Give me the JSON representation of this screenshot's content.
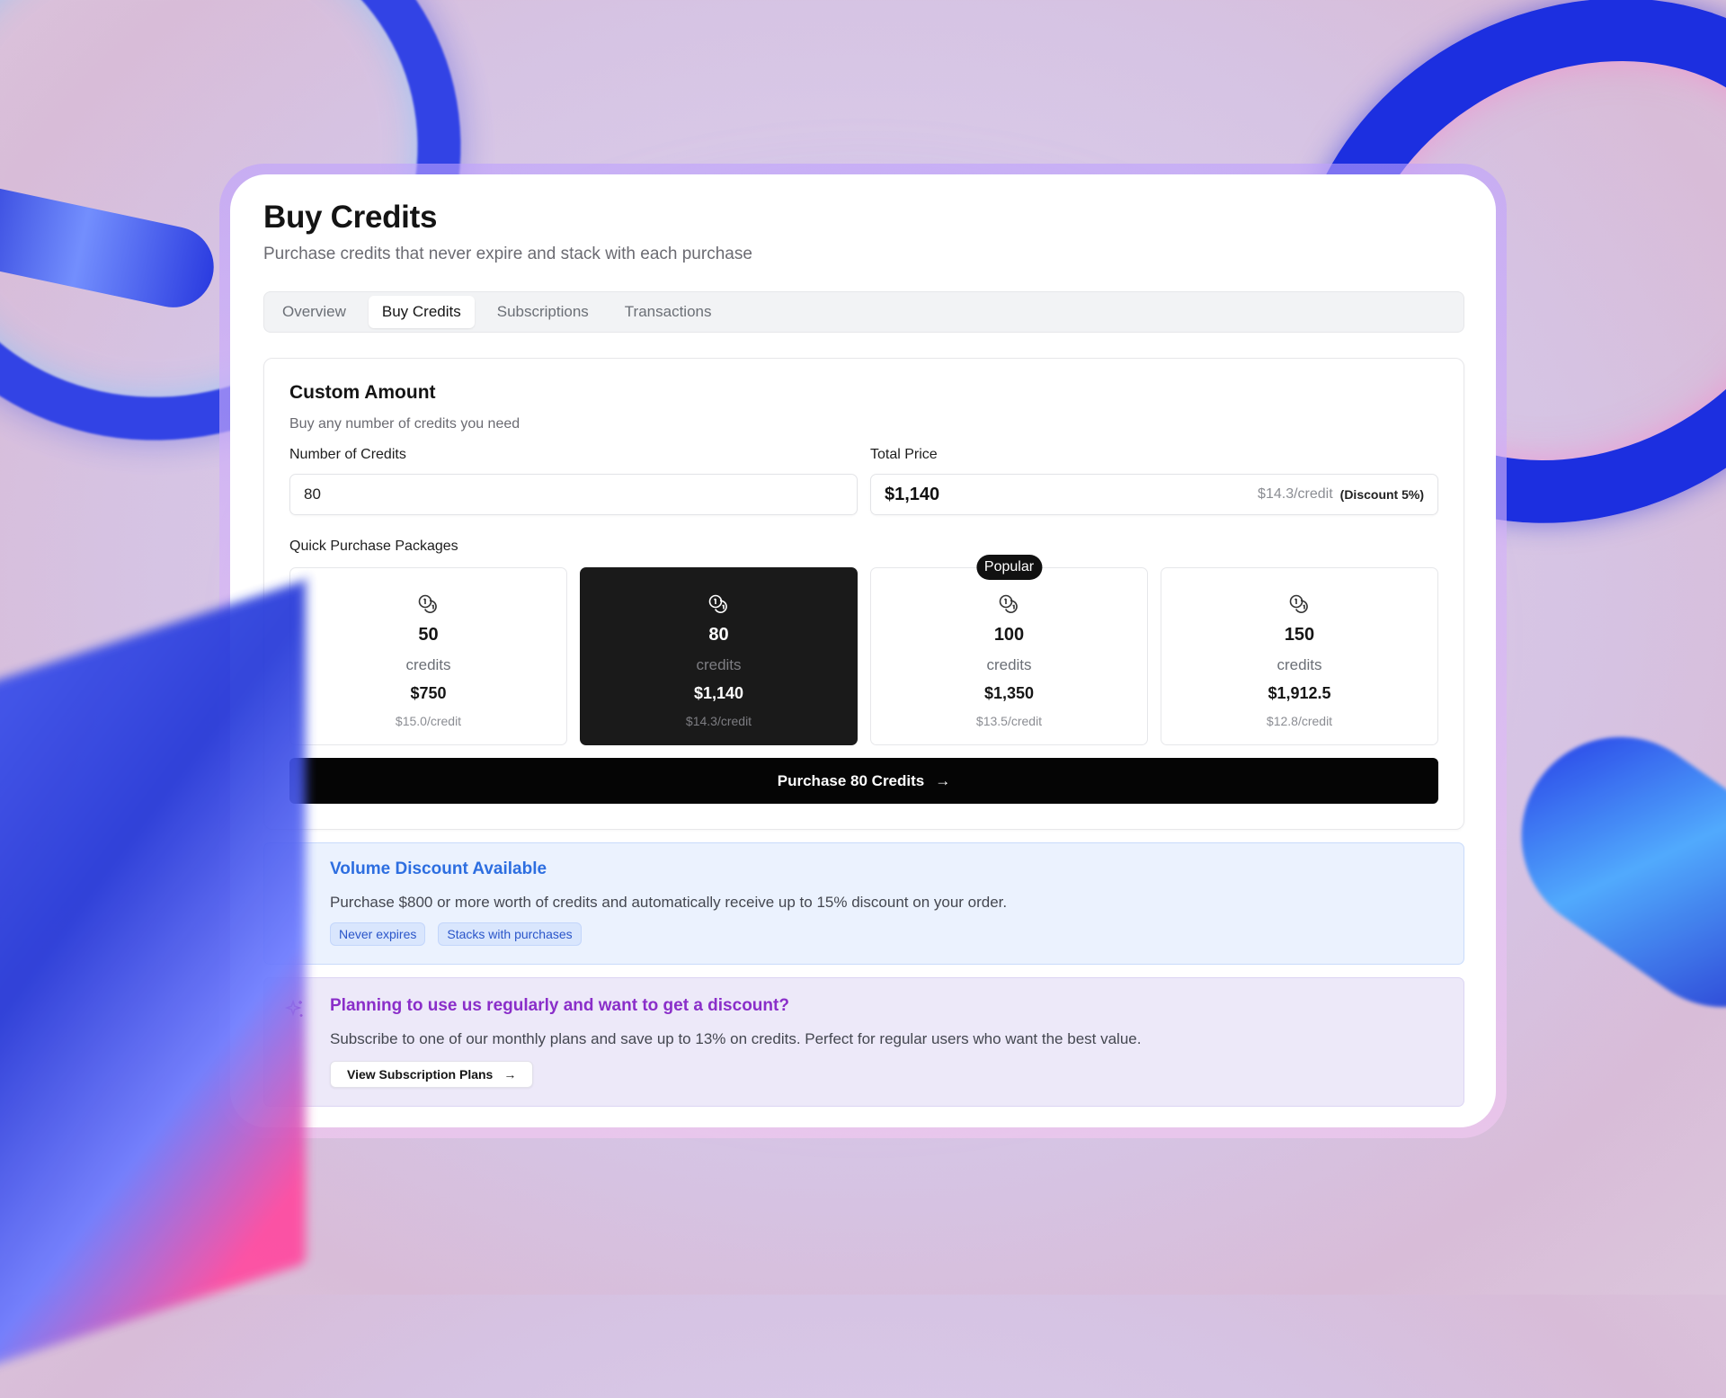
{
  "header": {
    "title": "Buy Credits",
    "subtitle": "Purchase credits that never expire and stack with each purchase"
  },
  "tabs": [
    {
      "label": "Overview",
      "active": false
    },
    {
      "label": "Buy Credits",
      "active": true
    },
    {
      "label": "Subscriptions",
      "active": false
    },
    {
      "label": "Transactions",
      "active": false
    }
  ],
  "custom_amount": {
    "title": "Custom Amount",
    "subtitle": "Buy any number of credits you need",
    "credits_label": "Number of Credits",
    "credits_value": "80",
    "total_label": "Total Price",
    "total_value": "$1,140",
    "per_credit": "$14.3/credit",
    "discount": "(Discount 5%)"
  },
  "packages": {
    "label": "Quick Purchase Packages",
    "unit": "credits",
    "popular_badge": "Popular",
    "items": [
      {
        "amount": "50",
        "price": "$750",
        "per_credit": "$15.0/credit",
        "selected": false,
        "popular": false
      },
      {
        "amount": "80",
        "price": "$1,140",
        "per_credit": "$14.3/credit",
        "selected": true,
        "popular": false
      },
      {
        "amount": "100",
        "price": "$1,350",
        "per_credit": "$13.5/credit",
        "selected": false,
        "popular": true
      },
      {
        "amount": "150",
        "price": "$1,912.5",
        "per_credit": "$12.8/credit",
        "selected": false,
        "popular": false
      }
    ]
  },
  "purchase_button": {
    "label": "Purchase 80 Credits",
    "icon": "arrow-right-icon"
  },
  "volume_discount": {
    "title": "Volume Discount Available",
    "text": "Purchase $800 or more worth of credits and automatically receive up to 15% discount on your order.",
    "chips": [
      "Never expires",
      "Stacks with purchases"
    ]
  },
  "subscription_promo": {
    "icon": "sparkle-icon",
    "title": "Planning to use us regularly and want to get a discount?",
    "text": "Subscribe to one of our monthly plans and save up to 13% on credits. Perfect for regular users who want the best value.",
    "button_label": "View Subscription Plans"
  },
  "colors": {
    "accent_blue": "#2d6ee0",
    "accent_purple": "#8a2ec9",
    "selected_package": "#1a1a1a",
    "primary_button": "#050505"
  }
}
